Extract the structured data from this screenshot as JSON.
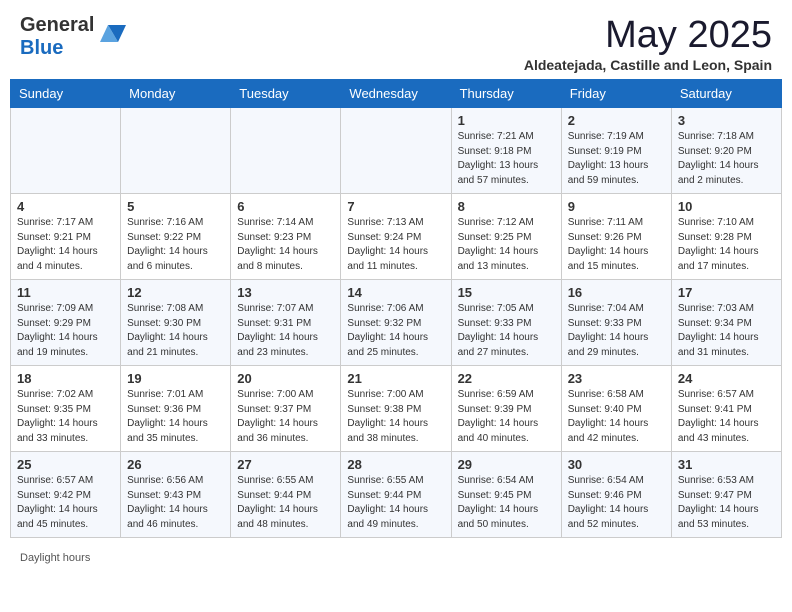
{
  "header": {
    "logo_general": "General",
    "logo_blue": "Blue",
    "month_title": "May 2025",
    "location": "Aldeatejada, Castille and Leon, Spain"
  },
  "weekdays": [
    "Sunday",
    "Monday",
    "Tuesday",
    "Wednesday",
    "Thursday",
    "Friday",
    "Saturday"
  ],
  "weeks": [
    [
      {
        "day": "",
        "info": ""
      },
      {
        "day": "",
        "info": ""
      },
      {
        "day": "",
        "info": ""
      },
      {
        "day": "",
        "info": ""
      },
      {
        "day": "1",
        "info": "Sunrise: 7:21 AM\nSunset: 9:18 PM\nDaylight: 13 hours\nand 57 minutes."
      },
      {
        "day": "2",
        "info": "Sunrise: 7:19 AM\nSunset: 9:19 PM\nDaylight: 13 hours\nand 59 minutes."
      },
      {
        "day": "3",
        "info": "Sunrise: 7:18 AM\nSunset: 9:20 PM\nDaylight: 14 hours\nand 2 minutes."
      }
    ],
    [
      {
        "day": "4",
        "info": "Sunrise: 7:17 AM\nSunset: 9:21 PM\nDaylight: 14 hours\nand 4 minutes."
      },
      {
        "day": "5",
        "info": "Sunrise: 7:16 AM\nSunset: 9:22 PM\nDaylight: 14 hours\nand 6 minutes."
      },
      {
        "day": "6",
        "info": "Sunrise: 7:14 AM\nSunset: 9:23 PM\nDaylight: 14 hours\nand 8 minutes."
      },
      {
        "day": "7",
        "info": "Sunrise: 7:13 AM\nSunset: 9:24 PM\nDaylight: 14 hours\nand 11 minutes."
      },
      {
        "day": "8",
        "info": "Sunrise: 7:12 AM\nSunset: 9:25 PM\nDaylight: 14 hours\nand 13 minutes."
      },
      {
        "day": "9",
        "info": "Sunrise: 7:11 AM\nSunset: 9:26 PM\nDaylight: 14 hours\nand 15 minutes."
      },
      {
        "day": "10",
        "info": "Sunrise: 7:10 AM\nSunset: 9:28 PM\nDaylight: 14 hours\nand 17 minutes."
      }
    ],
    [
      {
        "day": "11",
        "info": "Sunrise: 7:09 AM\nSunset: 9:29 PM\nDaylight: 14 hours\nand 19 minutes."
      },
      {
        "day": "12",
        "info": "Sunrise: 7:08 AM\nSunset: 9:30 PM\nDaylight: 14 hours\nand 21 minutes."
      },
      {
        "day": "13",
        "info": "Sunrise: 7:07 AM\nSunset: 9:31 PM\nDaylight: 14 hours\nand 23 minutes."
      },
      {
        "day": "14",
        "info": "Sunrise: 7:06 AM\nSunset: 9:32 PM\nDaylight: 14 hours\nand 25 minutes."
      },
      {
        "day": "15",
        "info": "Sunrise: 7:05 AM\nSunset: 9:33 PM\nDaylight: 14 hours\nand 27 minutes."
      },
      {
        "day": "16",
        "info": "Sunrise: 7:04 AM\nSunset: 9:33 PM\nDaylight: 14 hours\nand 29 minutes."
      },
      {
        "day": "17",
        "info": "Sunrise: 7:03 AM\nSunset: 9:34 PM\nDaylight: 14 hours\nand 31 minutes."
      }
    ],
    [
      {
        "day": "18",
        "info": "Sunrise: 7:02 AM\nSunset: 9:35 PM\nDaylight: 14 hours\nand 33 minutes."
      },
      {
        "day": "19",
        "info": "Sunrise: 7:01 AM\nSunset: 9:36 PM\nDaylight: 14 hours\nand 35 minutes."
      },
      {
        "day": "20",
        "info": "Sunrise: 7:00 AM\nSunset: 9:37 PM\nDaylight: 14 hours\nand 36 minutes."
      },
      {
        "day": "21",
        "info": "Sunrise: 7:00 AM\nSunset: 9:38 PM\nDaylight: 14 hours\nand 38 minutes."
      },
      {
        "day": "22",
        "info": "Sunrise: 6:59 AM\nSunset: 9:39 PM\nDaylight: 14 hours\nand 40 minutes."
      },
      {
        "day": "23",
        "info": "Sunrise: 6:58 AM\nSunset: 9:40 PM\nDaylight: 14 hours\nand 42 minutes."
      },
      {
        "day": "24",
        "info": "Sunrise: 6:57 AM\nSunset: 9:41 PM\nDaylight: 14 hours\nand 43 minutes."
      }
    ],
    [
      {
        "day": "25",
        "info": "Sunrise: 6:57 AM\nSunset: 9:42 PM\nDaylight: 14 hours\nand 45 minutes."
      },
      {
        "day": "26",
        "info": "Sunrise: 6:56 AM\nSunset: 9:43 PM\nDaylight: 14 hours\nand 46 minutes."
      },
      {
        "day": "27",
        "info": "Sunrise: 6:55 AM\nSunset: 9:44 PM\nDaylight: 14 hours\nand 48 minutes."
      },
      {
        "day": "28",
        "info": "Sunrise: 6:55 AM\nSunset: 9:44 PM\nDaylight: 14 hours\nand 49 minutes."
      },
      {
        "day": "29",
        "info": "Sunrise: 6:54 AM\nSunset: 9:45 PM\nDaylight: 14 hours\nand 50 minutes."
      },
      {
        "day": "30",
        "info": "Sunrise: 6:54 AM\nSunset: 9:46 PM\nDaylight: 14 hours\nand 52 minutes."
      },
      {
        "day": "31",
        "info": "Sunrise: 6:53 AM\nSunset: 9:47 PM\nDaylight: 14 hours\nand 53 minutes."
      }
    ]
  ],
  "footer": {
    "daylight_label": "Daylight hours"
  }
}
